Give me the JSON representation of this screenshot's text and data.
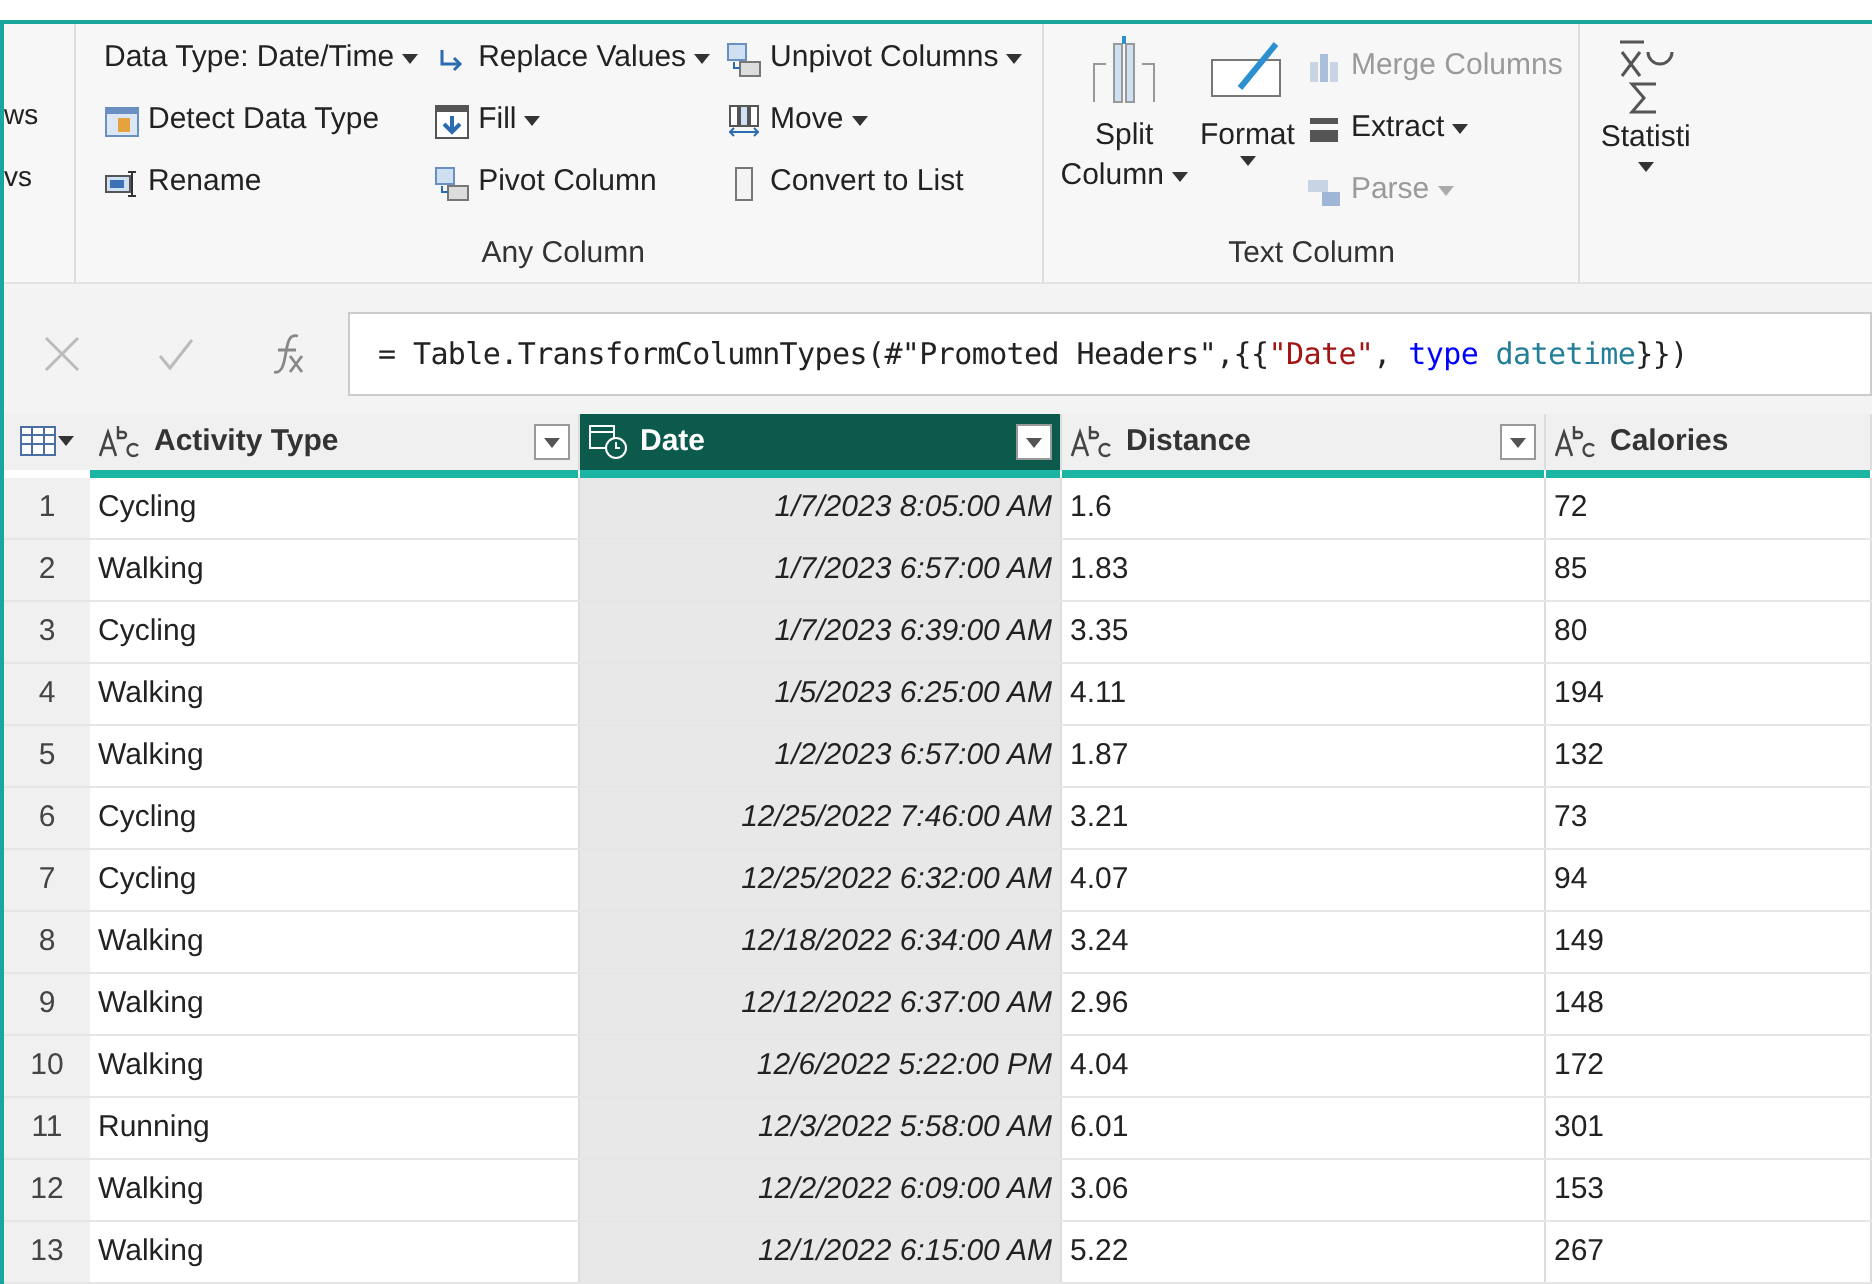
{
  "ribbon": {
    "cut_labels": [
      "ws",
      "vs"
    ],
    "any_column": {
      "label": "Any Column",
      "columns": [
        [
          {
            "label": "Data Type: Date/Time",
            "dropdown": true,
            "disabled": false
          },
          {
            "label": "Detect Data Type",
            "dropdown": false,
            "disabled": false
          },
          {
            "label": "Rename",
            "dropdown": false,
            "disabled": false
          }
        ],
        [
          {
            "label": "Replace Values",
            "dropdown": true,
            "disabled": false
          },
          {
            "label": "Fill",
            "dropdown": true,
            "disabled": false
          },
          {
            "label": "Pivot Column",
            "dropdown": false,
            "disabled": false
          }
        ],
        [
          {
            "label": "Unpivot Columns",
            "dropdown": true,
            "disabled": false
          },
          {
            "label": "Move",
            "dropdown": true,
            "disabled": false
          },
          {
            "label": "Convert to List",
            "dropdown": false,
            "disabled": false
          }
        ]
      ]
    },
    "text_column": {
      "label": "Text Column",
      "large": [
        {
          "label": "Split",
          "label2": "Column"
        },
        {
          "label": "Format"
        }
      ],
      "small": [
        {
          "label": "Merge Columns",
          "dropdown": false,
          "disabled": true
        },
        {
          "label": "Extract",
          "dropdown": true,
          "disabled": false
        },
        {
          "label": "Parse",
          "dropdown": true,
          "disabled": true
        }
      ]
    },
    "statistics": {
      "label": "Statisti"
    }
  },
  "formula": [
    {
      "kind": "plain",
      "text": "= Table.TransformColumnTypes(#\"Promoted Headers\",{{"
    },
    {
      "kind": "string",
      "text": "\"Date\""
    },
    {
      "kind": "plain",
      "text": ", "
    },
    {
      "kind": "keyword",
      "text": "type "
    },
    {
      "kind": "type",
      "text": "datetime"
    },
    {
      "kind": "plain",
      "text": "}})"
    }
  ],
  "table": {
    "columns": [
      {
        "name": "Activity Type",
        "kind": "text",
        "selected": false
      },
      {
        "name": "Date",
        "kind": "datetime",
        "selected": true
      },
      {
        "name": "Distance",
        "kind": "text",
        "selected": false
      },
      {
        "name": "Calories",
        "kind": "text",
        "selected": false
      }
    ],
    "rows": [
      [
        "1",
        "Cycling",
        "1/7/2023 8:05:00 AM",
        "1.6",
        "72"
      ],
      [
        "2",
        "Walking",
        "1/7/2023 6:57:00 AM",
        "1.83",
        "85"
      ],
      [
        "3",
        "Cycling",
        "1/7/2023 6:39:00 AM",
        "3.35",
        "80"
      ],
      [
        "4",
        "Walking",
        "1/5/2023 6:25:00 AM",
        "4.11",
        "194"
      ],
      [
        "5",
        "Walking",
        "1/2/2023 6:57:00 AM",
        "1.87",
        "132"
      ],
      [
        "6",
        "Cycling",
        "12/25/2022 7:46:00 AM",
        "3.21",
        "73"
      ],
      [
        "7",
        "Cycling",
        "12/25/2022 6:32:00 AM",
        "4.07",
        "94"
      ],
      [
        "8",
        "Walking",
        "12/18/2022 6:34:00 AM",
        "3.24",
        "149"
      ],
      [
        "9",
        "Walking",
        "12/12/2022 6:37:00 AM",
        "2.96",
        "148"
      ],
      [
        "10",
        "Walking",
        "12/6/2022 5:22:00 PM",
        "4.04",
        "172"
      ],
      [
        "11",
        "Running",
        "12/3/2022 5:58:00 AM",
        "6.01",
        "301"
      ],
      [
        "12",
        "Walking",
        "12/2/2022 6:09:00 AM",
        "3.06",
        "153"
      ],
      [
        "13",
        "Walking",
        "12/1/2022 6:15:00 AM",
        "5.22",
        "267"
      ]
    ]
  }
}
